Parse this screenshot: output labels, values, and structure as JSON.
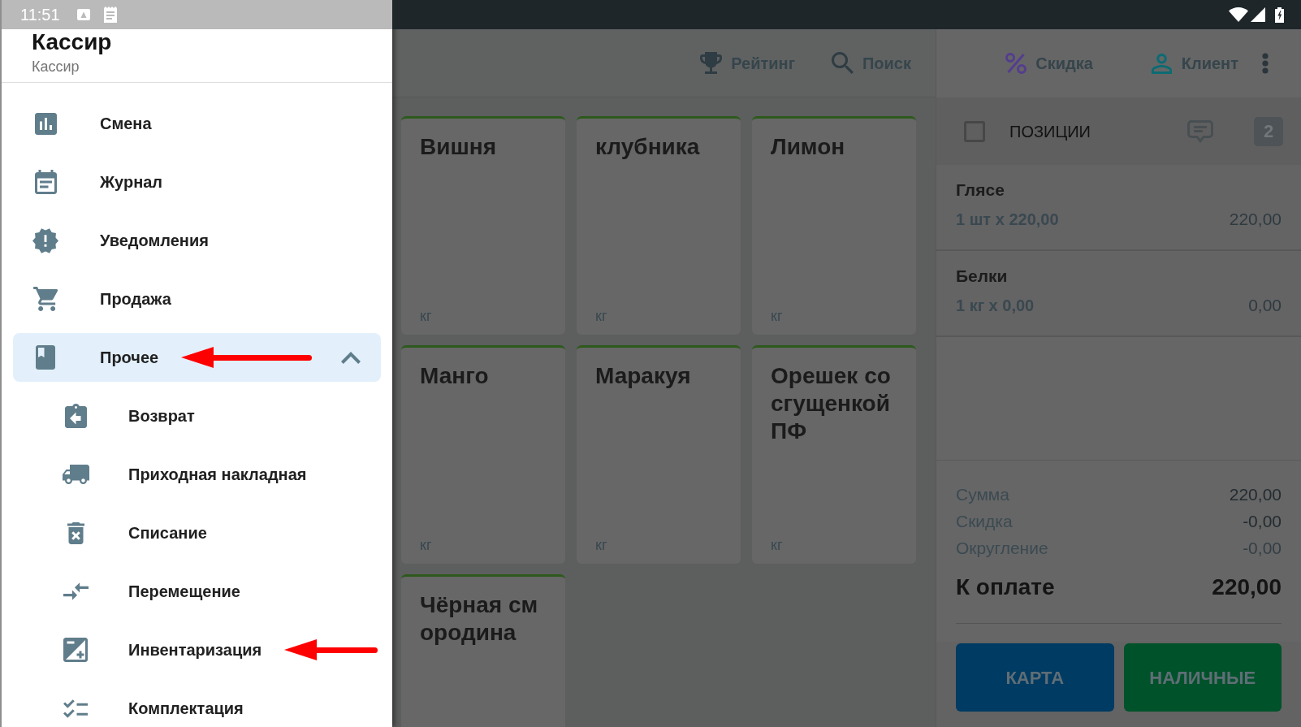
{
  "status_bar": {
    "time": "11:51"
  },
  "drawer": {
    "title": "Кассир",
    "subtitle": "Кассир",
    "items": [
      {
        "label": "Смена",
        "selected": false,
        "arrow": false
      },
      {
        "label": "Журнал",
        "selected": false,
        "arrow": false
      },
      {
        "label": "Уведомления",
        "selected": false,
        "arrow": false
      },
      {
        "label": "Продажа",
        "selected": false,
        "arrow": false
      },
      {
        "label": "Прочее",
        "selected": true,
        "expanded": true,
        "arrow": true,
        "children": [
          {
            "label": "Возврат",
            "selected": false,
            "arrow": false
          },
          {
            "label": "Приходная накладная",
            "selected": false,
            "arrow": false
          },
          {
            "label": "Списание",
            "selected": false,
            "arrow": false
          },
          {
            "label": "Перемещение",
            "selected": false,
            "arrow": false
          },
          {
            "label": "Инвентаризация",
            "selected": false,
            "arrow": true
          },
          {
            "label": "Комплектация",
            "selected": false,
            "arrow": false
          }
        ]
      }
    ]
  },
  "catalog": {
    "toolbar": [
      "Рейтинг",
      "Поиск"
    ],
    "products": [
      {
        "name": "Вишня",
        "unit": "кг"
      },
      {
        "name": "клубника",
        "unit": "кг"
      },
      {
        "name": "Лимон",
        "unit": "кг"
      },
      {
        "name": "Манго",
        "unit": "кг"
      },
      {
        "name": "Маракуя",
        "unit": "кг"
      },
      {
        "name": "Орешек со сгущенкой ПФ",
        "unit": "кг"
      },
      {
        "name": "Чёрная см ородина"
      }
    ]
  },
  "order": {
    "toolbar": [
      "Скидка",
      "Клиент"
    ],
    "header": {
      "title": "ПОЗИЦИИ",
      "checked": false,
      "count": "2"
    },
    "items": [
      {
        "name": "Глясе",
        "quantity": "1 шт х 220,00",
        "amount": "220,00"
      },
      {
        "name": "Белки",
        "quantity": "1 кг х 0,00",
        "amount": "0,00"
      }
    ],
    "totals": [
      {
        "label": "Сумма",
        "value": "220,00",
        "muted": false
      },
      {
        "label": "Скидка",
        "value": "-0,00",
        "muted": false
      },
      {
        "label": "Округление",
        "value": "-0,00",
        "muted": true
      }
    ],
    "amount_due": {
      "label": "К оплате",
      "value": "220,00"
    },
    "payment_buttons": [
      {
        "label": "КАРТА",
        "color": "#003b63"
      },
      {
        "label": "НАЛИЧНЫЕ",
        "color": "#00522a"
      }
    ]
  }
}
